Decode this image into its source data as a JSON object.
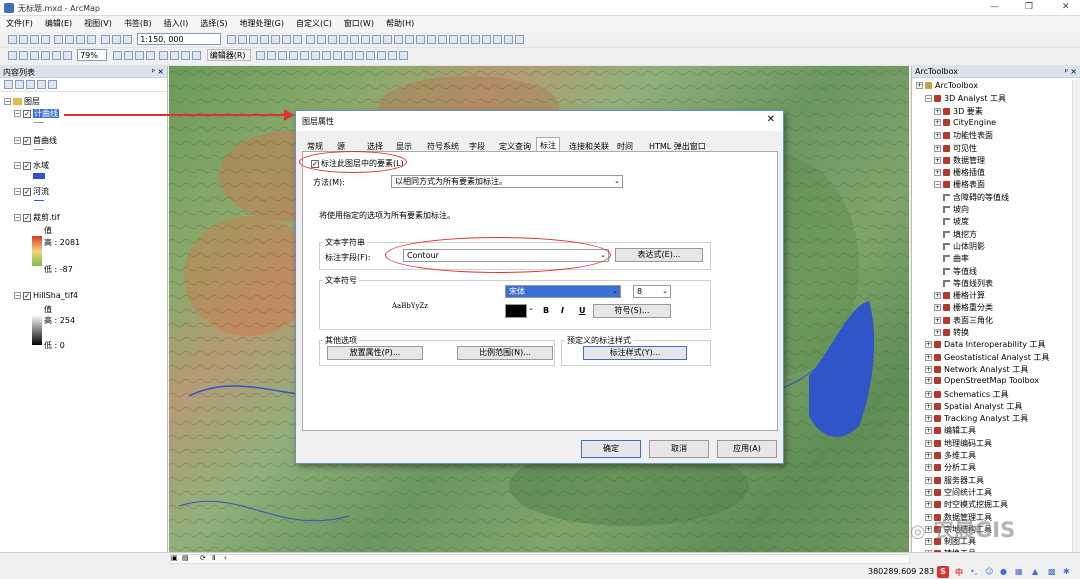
{
  "window": {
    "title": "无标题.mxd - ArcMap"
  },
  "menu": [
    "文件(F)",
    "编辑(E)",
    "视图(V)",
    "书签(B)",
    "插入(I)",
    "选择(S)",
    "地理处理(G)",
    "自定义(C)",
    "窗口(W)",
    "帮助(H)"
  ],
  "toolbar": {
    "scale": "1:150, 000",
    "zoom": "79%",
    "editor": "编辑器(R)"
  },
  "toc": {
    "title": "内容列表",
    "root": "图层",
    "layers": [
      {
        "name": "计曲线",
        "checked": true,
        "selected": true
      },
      {
        "name": "首曲线",
        "checked": true
      },
      {
        "name": "水域",
        "checked": true
      },
      {
        "name": "河流",
        "checked": true
      },
      {
        "name": "裁剪.tif",
        "checked": true,
        "value_label": "值",
        "high": "高 : 2081",
        "low": "低 : -87"
      },
      {
        "name": "HillSha_tif4",
        "checked": true,
        "value_label": "值",
        "high": "高 : 254",
        "low": "低 : 0"
      }
    ]
  },
  "dialog": {
    "title": "图层属性",
    "tabs": [
      "常规",
      "源",
      "选择",
      "显示",
      "符号系统",
      "字段",
      "定义查询",
      "标注",
      "连接和关联",
      "时间",
      "HTML 弹出窗口"
    ],
    "active_tab": "标注",
    "label_checkbox": "标注此图层中的要素(L)",
    "method_label": "方法(M):",
    "method_value": "以相同方式为所有要素加标注。",
    "info": "将使用指定的选项为所有要素加标注。",
    "text_string_group": "文本字符串",
    "label_field_label": "标注字段(F):",
    "label_field_value": "Contour",
    "expression_button": "表达式(E)...",
    "text_symbol_group": "文本符号",
    "preview_text": "AaBbYyZz",
    "font_name": "宋体",
    "font_size": "8",
    "bold": "B",
    "italic": "I",
    "underline": "U",
    "symbol_button": "符号(S)...",
    "other_options_group": "其他选项",
    "placement_button": "放置属性(P)...",
    "scale_range_button": "比例范围(N)...",
    "predefined_group": "预定义的标注样式",
    "label_styles_button": "标注样式(Y)...",
    "ok": "确定",
    "cancel": "取消",
    "apply": "应用(A)"
  },
  "arctoolbox": {
    "title": "ArcToolbox",
    "items": [
      {
        "label": "ArcToolbox",
        "level": 0,
        "kind": "root"
      },
      {
        "label": "3D Analyst 工具",
        "level": 1,
        "kind": "box",
        "open": true
      },
      {
        "label": "3D 要素",
        "level": 2,
        "kind": "box"
      },
      {
        "label": "CityEngine",
        "level": 2,
        "kind": "box"
      },
      {
        "label": "功能性表面",
        "level": 2,
        "kind": "box"
      },
      {
        "label": "可见性",
        "level": 2,
        "kind": "box"
      },
      {
        "label": "数据管理",
        "level": 2,
        "kind": "box"
      },
      {
        "label": "栅格插值",
        "level": 2,
        "kind": "box"
      },
      {
        "label": "栅格表面",
        "level": 2,
        "kind": "box",
        "open": true
      },
      {
        "label": "含障碍的等值线",
        "level": 3,
        "kind": "tool"
      },
      {
        "label": "坡向",
        "level": 3,
        "kind": "tool"
      },
      {
        "label": "坡度",
        "level": 3,
        "kind": "tool"
      },
      {
        "label": "填挖方",
        "level": 3,
        "kind": "tool"
      },
      {
        "label": "山体阴影",
        "level": 3,
        "kind": "tool"
      },
      {
        "label": "曲率",
        "level": 3,
        "kind": "tool"
      },
      {
        "label": "等值线",
        "level": 3,
        "kind": "tool"
      },
      {
        "label": "等值线列表",
        "level": 3,
        "kind": "tool"
      },
      {
        "label": "栅格计算",
        "level": 2,
        "kind": "box"
      },
      {
        "label": "栅格重分类",
        "level": 2,
        "kind": "box"
      },
      {
        "label": "表面三角化",
        "level": 2,
        "kind": "box"
      },
      {
        "label": "转换",
        "level": 2,
        "kind": "box"
      },
      {
        "label": "Data Interoperability 工具",
        "level": 1,
        "kind": "box"
      },
      {
        "label": "Geostatistical Analyst 工具",
        "level": 1,
        "kind": "box"
      },
      {
        "label": "Network Analyst 工具",
        "level": 1,
        "kind": "box"
      },
      {
        "label": "OpenStreetMap Toolbox",
        "level": 1,
        "kind": "box"
      },
      {
        "label": "Schematics 工具",
        "level": 1,
        "kind": "box"
      },
      {
        "label": "Spatial Analyst 工具",
        "level": 1,
        "kind": "box"
      },
      {
        "label": "Tracking Analyst 工具",
        "level": 1,
        "kind": "box"
      },
      {
        "label": "编辑工具",
        "level": 1,
        "kind": "box"
      },
      {
        "label": "地理编码工具",
        "level": 1,
        "kind": "box"
      },
      {
        "label": "多维工具",
        "level": 1,
        "kind": "box"
      },
      {
        "label": "分析工具",
        "level": 1,
        "kind": "box"
      },
      {
        "label": "服务器工具",
        "level": 1,
        "kind": "box"
      },
      {
        "label": "空间统计工具",
        "level": 1,
        "kind": "box"
      },
      {
        "label": "时空模式挖掘工具",
        "level": 1,
        "kind": "box"
      },
      {
        "label": "数据管理工具",
        "level": 1,
        "kind": "box"
      },
      {
        "label": "宗地结构工具",
        "level": 1,
        "kind": "box"
      },
      {
        "label": "制图工具",
        "level": 1,
        "kind": "box"
      },
      {
        "label": "转换工具",
        "level": 1,
        "kind": "box"
      }
    ]
  },
  "status": {
    "coords": "380289.609  283"
  },
  "watermark": "农晨GIS",
  "colors": {
    "water": "#2f55c8",
    "highlight": "#3b6fd6",
    "annotation": "#e03030"
  }
}
